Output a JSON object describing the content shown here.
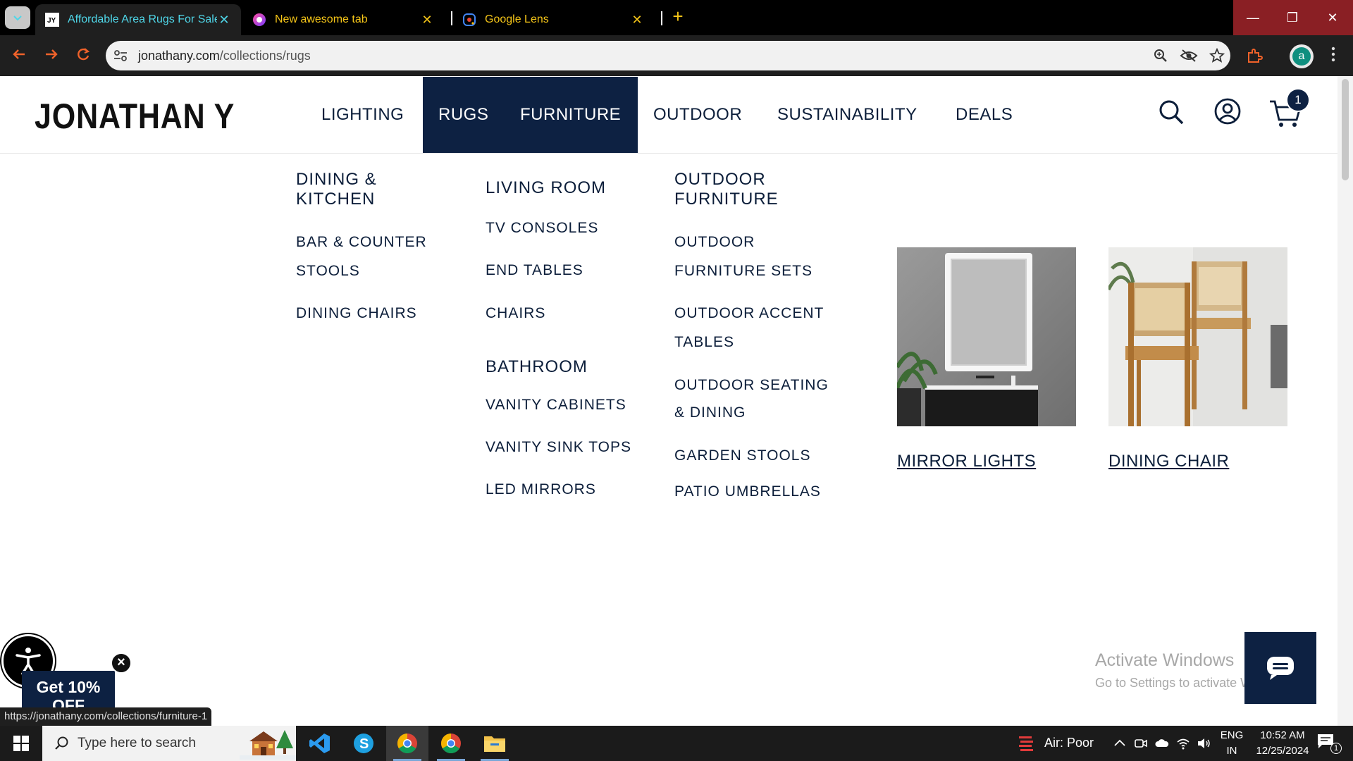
{
  "browser": {
    "tabs": [
      {
        "title": "Affordable Area Rugs For Sale, V",
        "favicon": "jonathan-y-favicon",
        "active": true
      },
      {
        "title": "New awesome tab",
        "favicon": "gradient-circle-favicon",
        "active": false
      },
      {
        "title": "Google Lens",
        "favicon": "google-lens-favicon",
        "active": false
      }
    ],
    "tab_close": "✕",
    "new_tab": "+",
    "window_controls": {
      "minimize": "—",
      "restore": "❐",
      "close": "✕"
    },
    "url_host": "jonathany.com",
    "url_path": "/collections/rugs",
    "profile_initial": "a",
    "accent_color": "#f0622a"
  },
  "site": {
    "logo": "JONATHAN Y",
    "nav": [
      {
        "label": "LIGHTING"
      },
      {
        "label": "RUGS"
      },
      {
        "label": "FURNITURE"
      },
      {
        "label": "OUTDOOR"
      },
      {
        "label": "SUSTAINABILITY"
      },
      {
        "label": "DEALS"
      }
    ],
    "cart_count": "1",
    "brand_color": "#0d2142"
  },
  "mega_menu": {
    "col1": {
      "heading_line1": "DINING &",
      "heading_line2": "KITCHEN",
      "items": [
        "BAR & COUNTER",
        "STOOLS",
        "DINING CHAIRS"
      ]
    },
    "col2": {
      "heading": "LIVING ROOM",
      "items": [
        "TV CONSOLES",
        "END TABLES",
        "CHAIRS"
      ],
      "heading2": "BATHROOM",
      "items2": [
        "VANITY CABINETS",
        "VANITY SINK TOPS",
        "LED MIRRORS"
      ]
    },
    "col3": {
      "heading_line1": "OUTDOOR",
      "heading_line2": "FURNITURE",
      "items": [
        "OUTDOOR",
        "FURNITURE SETS",
        "OUTDOOR ACCENT",
        "TABLES",
        "OUTDOOR SEATING",
        "& DINING",
        "GARDEN STOOLS",
        "PATIO UMBRELLAS"
      ]
    },
    "promos": [
      {
        "label": "MIRROR LIGHTS"
      },
      {
        "label": "DINING CHAIR"
      }
    ]
  },
  "overlays": {
    "activate_title": "Activate Windows",
    "activate_sub": "Go to Settings to activate Windows.",
    "promo_line1": "Get 10%",
    "promo_line2": "OFF",
    "promo_close": "×",
    "status_url": "https://jonathany.com/collections/furniture-1"
  },
  "taskbar": {
    "search_placeholder": "Type here to search",
    "air_quality": "Air: Poor",
    "lang_line1": "ENG",
    "lang_line2": "IN",
    "time": "10:52 AM",
    "date": "12/25/2024",
    "notification_count": "1"
  }
}
